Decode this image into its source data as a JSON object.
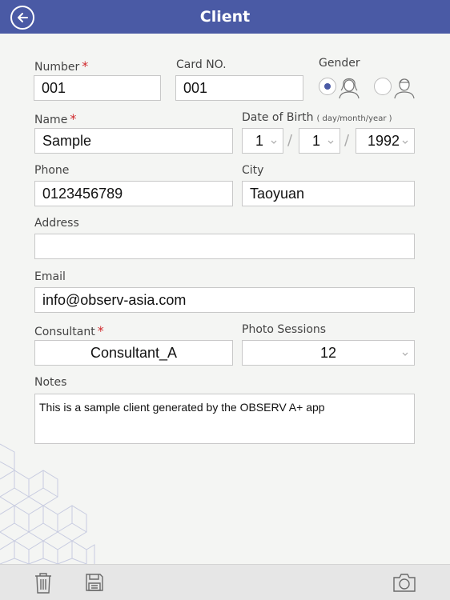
{
  "header": {
    "title": "Client",
    "back_icon": "back-arrow-circle-icon"
  },
  "form": {
    "number": {
      "label": "Number",
      "value": "001"
    },
    "card_no": {
      "label": "Card NO.",
      "value": "001"
    },
    "gender": {
      "label": "Gender",
      "options": [
        "female",
        "male"
      ],
      "selected": "female"
    },
    "name": {
      "label": "Name",
      "value": "Sample"
    },
    "dob": {
      "label": "Date of Birth",
      "hint": "( day/month/year )",
      "day": "1",
      "month": "1",
      "year": "1992",
      "separator": "/"
    },
    "phone": {
      "label": "Phone",
      "value": "0123456789"
    },
    "city": {
      "label": "City",
      "value": "Taoyuan"
    },
    "address": {
      "label": "Address",
      "value": ""
    },
    "email": {
      "label": "Email",
      "value": "info@observ-asia.com"
    },
    "consultant": {
      "label": "Consultant",
      "value": "Consultant_A"
    },
    "photo_sessions": {
      "label": "Photo Sessions",
      "value": "12"
    },
    "notes": {
      "label": "Notes",
      "value": "This is a sample client generated by the OBSERV A+ app"
    },
    "required_mark": "*"
  },
  "footer": {
    "icons": [
      "trash-icon",
      "save-disk-icon",
      "camera-icon"
    ]
  },
  "colors": {
    "header": "#4a5aa5",
    "required": "#d0282c",
    "background": "#f4f5f3"
  }
}
